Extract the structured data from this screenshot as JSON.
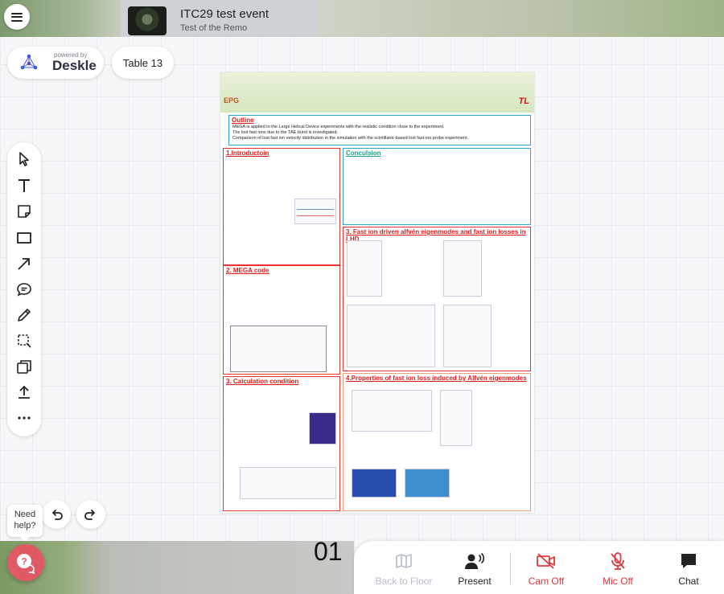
{
  "event": {
    "title": "ITC29 test event",
    "subtitle": "Test of the Remo"
  },
  "brand": {
    "powered_by": "powered by",
    "name": "Deskle"
  },
  "table": {
    "label": "Table 13"
  },
  "toolbar": {
    "tools": [
      "pointer-icon",
      "text-icon",
      "sticky-note-icon",
      "rectangle-icon",
      "arrow-icon",
      "comment-icon",
      "pencil-icon",
      "select-area-icon",
      "layers-icon",
      "upload-icon",
      "more-icon"
    ]
  },
  "help": {
    "tip": "Need help?"
  },
  "bottom": {
    "floor_number": "01"
  },
  "controls": {
    "back_to_floor": "Back to Floor",
    "present": "Present",
    "cam_off": "Cam Off",
    "mic_off": "Mic Off",
    "chat": "Chat"
  },
  "poster": {
    "logo_left": "EPG",
    "logo_right": "TL",
    "outline": {
      "title": "Outline",
      "items": [
        "MEGA is applied to the Large Helical Device experiments with the realistic condition close to the experiment.",
        "The lost fast ions due to the TAE burst is investigated.",
        "Comparison of lost fast ion velocity distribution in the simulation with the scintillator-based lost fast-ion probe experiment."
      ]
    },
    "intro": {
      "title": "1.Introductoin"
    },
    "mega": {
      "title": "2. MEGA code"
    },
    "calc": {
      "title": "3. Calculation condition"
    },
    "conclusion": {
      "title": "Conculsion"
    },
    "sec3": {
      "title": "3. Fast ion driven alfvén eigenmodes and fast ion losses in LHD"
    },
    "sec4": {
      "title": "4.Properties of fast ion loss induced by Alfvén eigenmodes"
    }
  },
  "colors": {
    "accent_red": "#e0373c",
    "poster_red": "#e33",
    "poster_cyan": "#2aa3d8"
  }
}
